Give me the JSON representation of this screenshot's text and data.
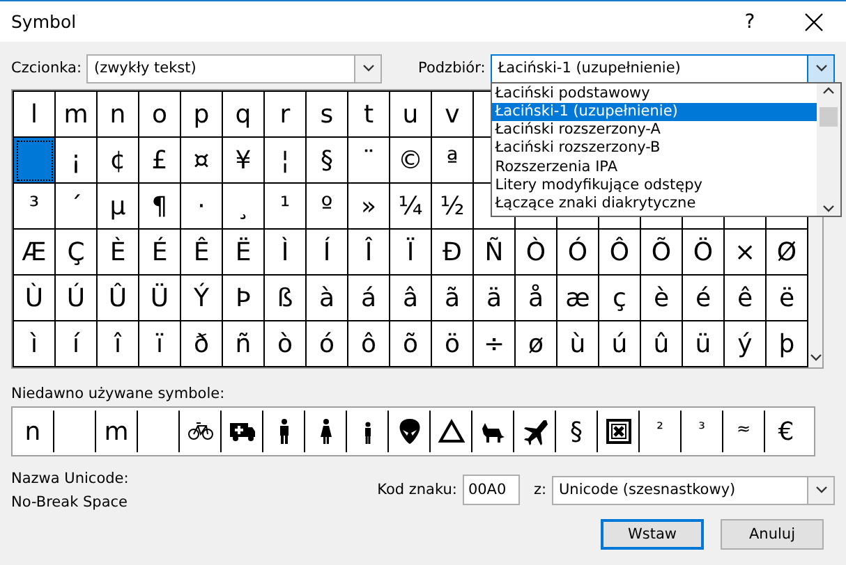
{
  "window": {
    "title": "Symbol",
    "help": "?"
  },
  "font_field": {
    "label": "Czcionka:",
    "value": "(zwykły tekst)"
  },
  "subset_field": {
    "label": "Podzbiór:",
    "value": "Łaciński-1 (uzupełnienie)",
    "expanded": true,
    "options": [
      {
        "label": "Łaciński podstawowy",
        "selected": false
      },
      {
        "label": "Łaciński-1 (uzupełnienie)",
        "selected": true
      },
      {
        "label": "Łaciński rozszerzony-A",
        "selected": false
      },
      {
        "label": "Łaciński rozszerzony-B",
        "selected": false
      },
      {
        "label": "Rozszerzenia IPA",
        "selected": false
      },
      {
        "label": "Litery modyfikujące odstępy",
        "selected": false
      },
      {
        "label": "Łączące znaki diakrytyczne",
        "selected": false
      }
    ]
  },
  "symbol_grid": {
    "rows": [
      [
        {
          "char": "l"
        },
        {
          "char": "m"
        },
        {
          "char": "n"
        },
        {
          "char": "o"
        },
        {
          "char": "p"
        },
        {
          "char": "q"
        },
        {
          "char": "r"
        },
        {
          "char": "s"
        },
        {
          "char": "t"
        },
        {
          "char": "u"
        },
        {
          "char": "v"
        }
      ],
      [
        {
          "selected": true
        },
        {
          "char": "¡"
        },
        {
          "char": "¢"
        },
        {
          "char": "£"
        },
        {
          "char": "¤"
        },
        {
          "char": "¥"
        },
        {
          "char": "¦"
        },
        {
          "char": "§"
        },
        {
          "char": "¨"
        },
        {
          "char": "©"
        },
        {
          "char": "ª"
        }
      ],
      [
        {
          "char": "³"
        },
        {
          "char": "´"
        },
        {
          "char": "µ"
        },
        {
          "char": "¶"
        },
        {
          "char": "·"
        },
        {
          "char": "¸"
        },
        {
          "char": "¹"
        },
        {
          "char": "º"
        },
        {
          "char": "»"
        },
        {
          "char": "¼"
        },
        {
          "char": "½"
        }
      ],
      [
        {
          "char": "Æ"
        },
        {
          "char": "Ç"
        },
        {
          "char": "È"
        },
        {
          "char": "É"
        },
        {
          "char": "Ê"
        },
        {
          "char": "Ë"
        },
        {
          "char": "Ì"
        },
        {
          "char": "Í"
        },
        {
          "char": "Î"
        },
        {
          "char": "Ï"
        },
        {
          "char": "Ð"
        },
        {
          "char": "Ñ"
        },
        {
          "char": "Ò"
        },
        {
          "char": "Ó"
        },
        {
          "char": "Ô"
        },
        {
          "char": "Õ"
        },
        {
          "char": "Ö"
        },
        {
          "char": "×"
        },
        {
          "char": "Ø"
        }
      ],
      [
        {
          "char": "Ù"
        },
        {
          "char": "Ú"
        },
        {
          "char": "Û"
        },
        {
          "char": "Ü"
        },
        {
          "char": "Ý"
        },
        {
          "char": "Þ"
        },
        {
          "char": "ß"
        },
        {
          "char": "à"
        },
        {
          "char": "á"
        },
        {
          "char": "â"
        },
        {
          "char": "ã"
        },
        {
          "char": "ä"
        },
        {
          "char": "å"
        },
        {
          "char": "æ"
        },
        {
          "char": "ç"
        },
        {
          "char": "è"
        },
        {
          "char": "é"
        },
        {
          "char": "ê"
        },
        {
          "char": "ë"
        }
      ],
      [
        {
          "char": "ì"
        },
        {
          "char": "í"
        },
        {
          "char": "î"
        },
        {
          "char": "ï"
        },
        {
          "char": "ð"
        },
        {
          "char": "ñ"
        },
        {
          "char": "ò"
        },
        {
          "char": "ó"
        },
        {
          "char": "ô"
        },
        {
          "char": "õ"
        },
        {
          "char": "ö"
        },
        {
          "char": "÷"
        },
        {
          "char": "ø"
        },
        {
          "char": "ù"
        },
        {
          "char": "ú"
        },
        {
          "char": "û"
        },
        {
          "char": "ü"
        },
        {
          "char": "ý"
        },
        {
          "char": "þ"
        }
      ]
    ]
  },
  "recent": {
    "label": "Niedawno używane symbole:",
    "items": [
      {
        "kind": "char",
        "text": "n"
      },
      {
        "kind": "blank"
      },
      {
        "kind": "char",
        "text": "m"
      },
      {
        "kind": "blank"
      },
      {
        "kind": "icon"
      },
      {
        "kind": "icon"
      },
      {
        "kind": "icon"
      },
      {
        "kind": "icon"
      },
      {
        "kind": "icon"
      },
      {
        "kind": "icon"
      },
      {
        "kind": "icon"
      },
      {
        "kind": "icon"
      },
      {
        "kind": "icon"
      },
      {
        "kind": "char",
        "text": "§"
      },
      {
        "kind": "icon"
      },
      {
        "kind": "char",
        "text": "²"
      },
      {
        "kind": "char",
        "text": "³"
      },
      {
        "kind": "char",
        "text": "≈"
      },
      {
        "kind": "char",
        "text": "€"
      }
    ]
  },
  "unicode_name": {
    "label": "Nazwa Unicode:",
    "value": "No-Break Space"
  },
  "char_code": {
    "label": "Kod znaku:",
    "value": "00A0"
  },
  "from_field": {
    "label": "z:",
    "value": "Unicode (szesnastkowy)"
  },
  "buttons": [
    {
      "label": "Wstaw",
      "default": true
    },
    {
      "label": "Anuluj",
      "default": false
    }
  ]
}
